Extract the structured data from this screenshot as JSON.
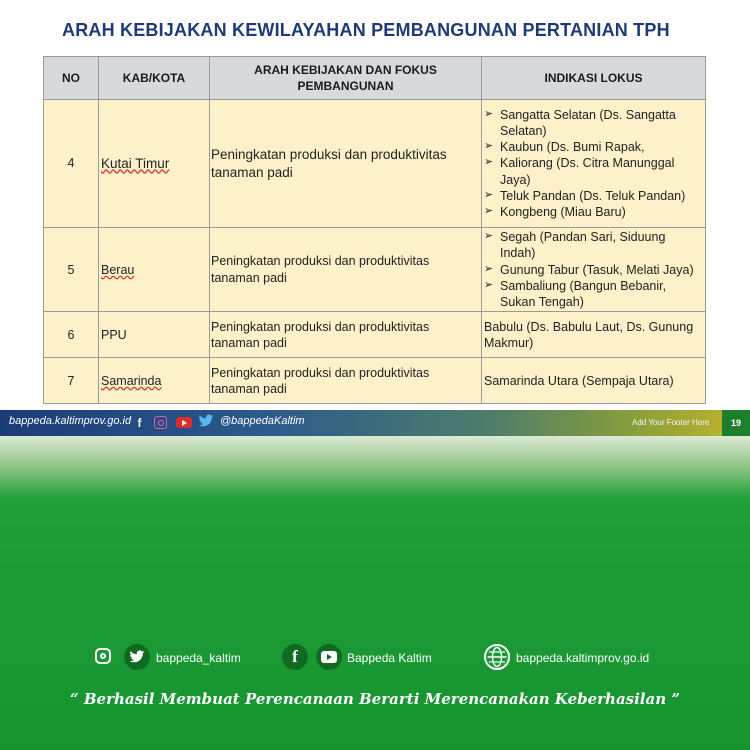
{
  "title": "ARAH KEBIJAKAN KEWILAYAHAN PEMBANGUNAN PERTANIAN TPH",
  "table": {
    "headers": [
      "NO",
      "KAB/KOTA",
      "ARAH KEBIJAKAN DAN FOKUS PEMBANGUNAN",
      "INDIKASI LOKUS"
    ],
    "rows": [
      {
        "no": "4",
        "kab": "Kutai Timur",
        "fokus": "Peningkatan produksi dan produktivitas tanaman padi",
        "lokus": [
          "Sangatta Selatan (Ds. Sangatta Selatan)",
          "Kaubun (Ds. Bumi Rapak,",
          "Kaliorang (Ds. Citra Manunggal Jaya)",
          "Teluk Pandan (Ds. Teluk Pandan)",
          "Kongbeng (Miau Baru)"
        ]
      },
      {
        "no": "5",
        "kab": "Berau",
        "fokus": "Peningkatan produksi dan produktivitas tanaman padi",
        "lokus": [
          "Segah (Pandan Sari, Siduung Indah)",
          "Gunung Tabur (Tasuk, Melati Jaya)",
          "Sambaliung (Bangun Bebanir, Sukan Tengah)"
        ]
      },
      {
        "no": "6",
        "kab": "PPU",
        "fokus": "Peningkatan produksi dan produktivitas tanaman padi",
        "lokus_text": "Babulu (Ds. Babulu Laut, Ds. Gunung Makmur)"
      },
      {
        "no": "7",
        "kab": "Samarinda",
        "fokus": "Peningkatan produksi dan produktivitas tanaman padi",
        "lokus_text": "Samarinda Utara (Sempaja Utara)"
      }
    ]
  },
  "footer_bar": {
    "site": "bappeda.kaltimprov.go.id",
    "handle": "@bappedaKaltim",
    "add_footer": "Add Your Footer Here",
    "page": "19"
  },
  "social": {
    "twitter": "bappeda_kaltim",
    "facebook_youtube": "Bappeda Kaltim",
    "website": "bappeda.kaltimprov.go.id"
  },
  "quote": "“ Berhasil  Membuat Perencanaan Berarti Merencanakan Keberhasilan ”",
  "colors": {
    "title": "#1f3a78",
    "header_bg": "#d7d9dd",
    "cell_bg": "#fdf1c9",
    "green": "#16932f"
  },
  "icons": [
    "facebook-icon",
    "instagram-icon",
    "youtube-icon",
    "twitter-icon",
    "globe-icon"
  ]
}
